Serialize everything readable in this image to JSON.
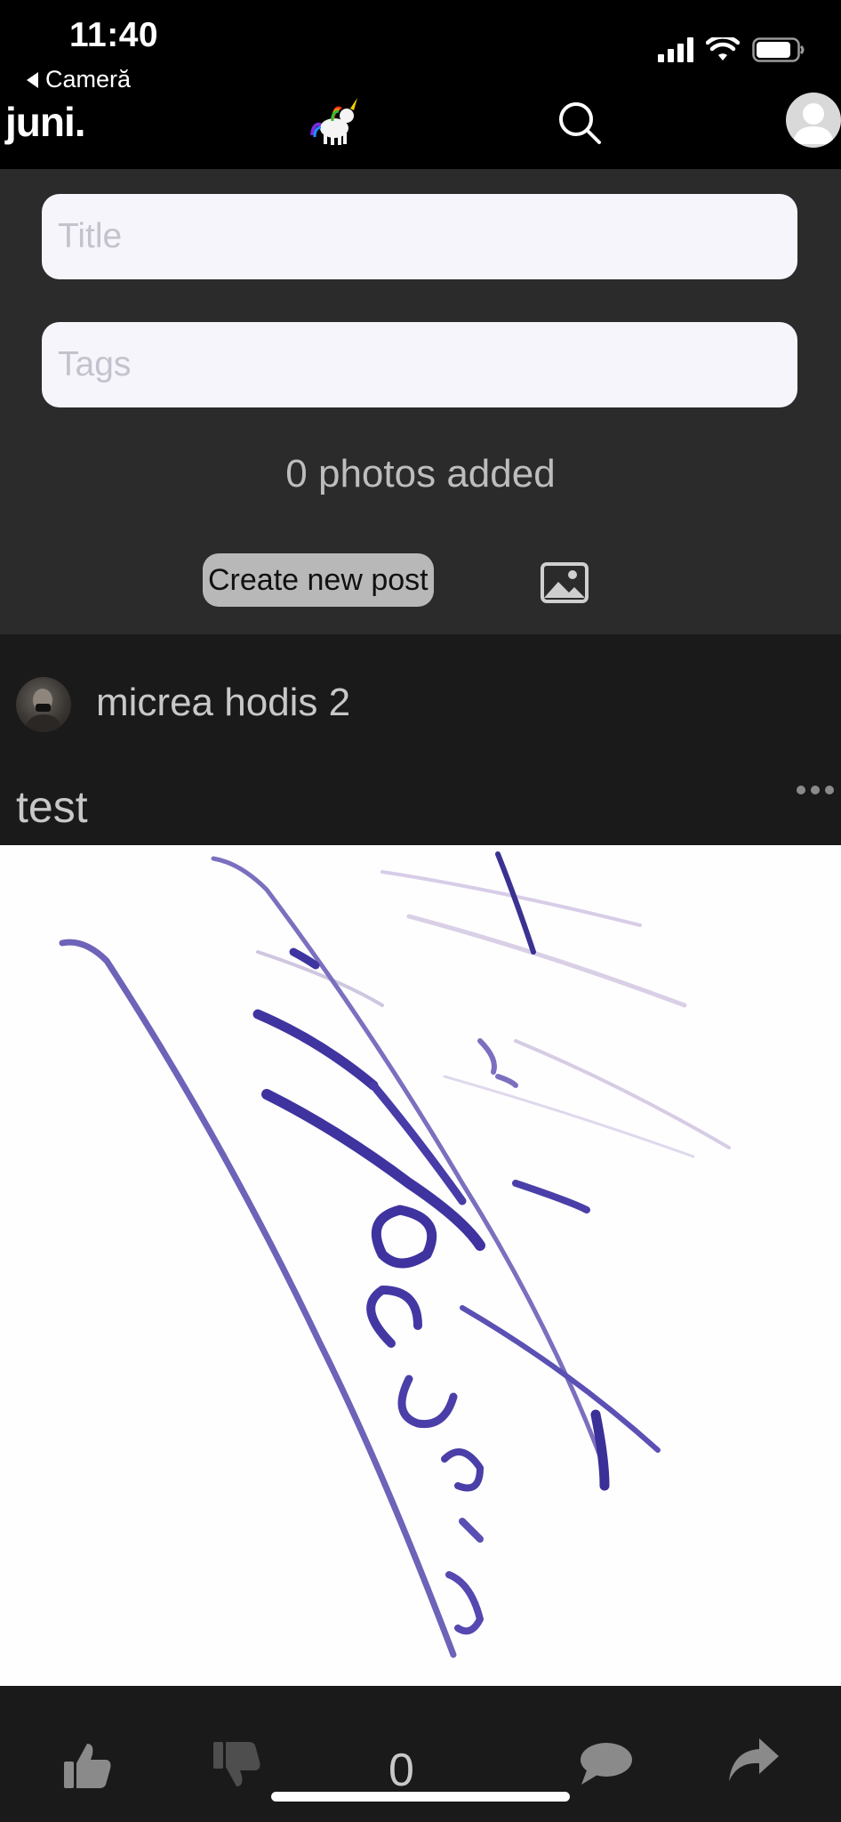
{
  "status_bar": {
    "time": "11:40",
    "back_app": "Cameră"
  },
  "header": {
    "brand": "juni.",
    "logo_icon": "unicorn-icon",
    "search_icon": "search-icon",
    "avatar_icon": "user-avatar-icon"
  },
  "composer": {
    "title_placeholder": "Title",
    "tags_placeholder": "Tags",
    "photos_status": "0 photos added",
    "create_button": "Create new post",
    "add_image_icon": "image-icon"
  },
  "post": {
    "author": "micrea hodis 2",
    "title": "test",
    "more_icon": "ellipsis-icon",
    "score": "0",
    "actions": {
      "like_icon": "thumbs-up-icon",
      "dislike_icon": "thumbs-down-icon",
      "comment_icon": "comment-icon",
      "share_icon": "share-icon"
    }
  },
  "colors": {
    "background": "#000000",
    "composer_bg": "#2b2b2b",
    "post_bg": "#1a1a1a",
    "input_bg": "#f6f5fb",
    "button_bg": "#b8b8b8",
    "ink": "#4a3fa8"
  }
}
